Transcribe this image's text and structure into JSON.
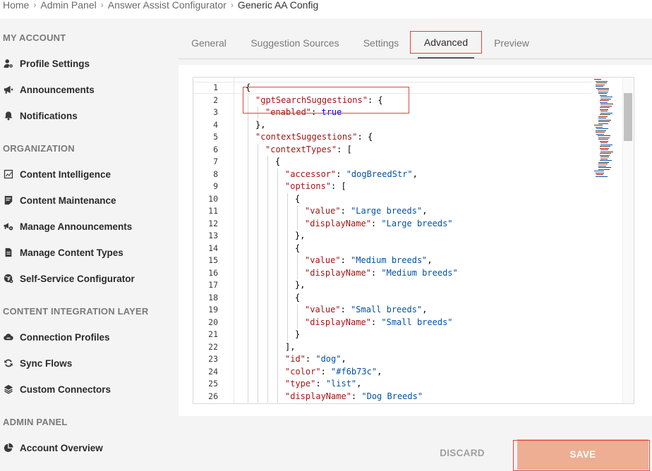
{
  "breadcrumb": {
    "items": [
      "Home",
      "Admin Panel",
      "Answer Assist Configurator"
    ],
    "current": "Generic AA Config",
    "separator": "›"
  },
  "sidebar": {
    "sections": [
      {
        "title": "MY ACCOUNT",
        "items": [
          {
            "label": "Profile Settings",
            "icon": "user-gear-icon"
          },
          {
            "label": "Announcements",
            "icon": "megaphone-icon"
          },
          {
            "label": "Notifications",
            "icon": "bell-icon"
          }
        ]
      },
      {
        "title": "ORGANIZATION",
        "items": [
          {
            "label": "Content Intelligence",
            "icon": "chart-icon"
          },
          {
            "label": "Content Maintenance",
            "icon": "list-check-icon"
          },
          {
            "label": "Manage Announcements",
            "icon": "megaphone-gear-icon"
          },
          {
            "label": "Manage Content Types",
            "icon": "document-icon"
          },
          {
            "label": "Self-Service Configurator",
            "icon": "globe-gear-icon"
          }
        ]
      },
      {
        "title": "CONTENT INTEGRATION LAYER",
        "items": [
          {
            "label": "Connection Profiles",
            "icon": "cloud-icon"
          },
          {
            "label": "Sync Flows",
            "icon": "sync-icon"
          },
          {
            "label": "Custom Connectors",
            "icon": "layers-icon"
          }
        ]
      },
      {
        "title": "ADMIN PANEL",
        "items": [
          {
            "label": "Account Overview",
            "icon": "pie-chart-icon"
          }
        ]
      }
    ]
  },
  "tabs": [
    {
      "label": "General",
      "active": false
    },
    {
      "label": "Suggestion Sources",
      "active": false
    },
    {
      "label": "Settings",
      "active": false
    },
    {
      "label": "Advanced",
      "active": true
    },
    {
      "label": "Preview",
      "active": false
    }
  ],
  "editor": {
    "lines": [
      {
        "n": "1",
        "indent": 0,
        "tokens": [
          [
            "p",
            "{"
          ]
        ]
      },
      {
        "n": "2",
        "indent": 1,
        "tokens": [
          [
            "k",
            "\"gptSearchSuggestions\""
          ],
          [
            "p",
            ": {"
          ]
        ]
      },
      {
        "n": "3",
        "indent": 2,
        "tokens": [
          [
            "k",
            "\"enabled\""
          ],
          [
            "p",
            ": "
          ],
          [
            "b",
            "true"
          ]
        ]
      },
      {
        "n": "4",
        "indent": 1,
        "tokens": [
          [
            "p",
            "},"
          ]
        ]
      },
      {
        "n": "5",
        "indent": 1,
        "tokens": [
          [
            "k",
            "\"contextSuggestions\""
          ],
          [
            "p",
            ": {"
          ]
        ]
      },
      {
        "n": "6",
        "indent": 2,
        "tokens": [
          [
            "k",
            "\"contextTypes\""
          ],
          [
            "p",
            ": ["
          ]
        ]
      },
      {
        "n": "7",
        "indent": 3,
        "tokens": [
          [
            "p",
            "{"
          ]
        ]
      },
      {
        "n": "8",
        "indent": 4,
        "tokens": [
          [
            "k",
            "\"accessor\""
          ],
          [
            "p",
            ": "
          ],
          [
            "s",
            "\"dogBreedStr\""
          ],
          [
            "p",
            ","
          ]
        ]
      },
      {
        "n": "9",
        "indent": 4,
        "tokens": [
          [
            "k",
            "\"options\""
          ],
          [
            "p",
            ": ["
          ]
        ]
      },
      {
        "n": "10",
        "indent": 5,
        "tokens": [
          [
            "p",
            "{"
          ]
        ]
      },
      {
        "n": "11",
        "indent": 6,
        "tokens": [
          [
            "k",
            "\"value\""
          ],
          [
            "p",
            ": "
          ],
          [
            "s",
            "\"Large breeds\""
          ],
          [
            "p",
            ","
          ]
        ]
      },
      {
        "n": "12",
        "indent": 6,
        "tokens": [
          [
            "k",
            "\"displayName\""
          ],
          [
            "p",
            ": "
          ],
          [
            "s",
            "\"Large breeds\""
          ]
        ]
      },
      {
        "n": "13",
        "indent": 5,
        "tokens": [
          [
            "p",
            "},"
          ]
        ]
      },
      {
        "n": "14",
        "indent": 5,
        "tokens": [
          [
            "p",
            "{"
          ]
        ]
      },
      {
        "n": "15",
        "indent": 6,
        "tokens": [
          [
            "k",
            "\"value\""
          ],
          [
            "p",
            ": "
          ],
          [
            "s",
            "\"Medium breeds\""
          ],
          [
            "p",
            ","
          ]
        ]
      },
      {
        "n": "16",
        "indent": 6,
        "tokens": [
          [
            "k",
            "\"displayName\""
          ],
          [
            "p",
            ": "
          ],
          [
            "s",
            "\"Medium breeds\""
          ]
        ]
      },
      {
        "n": "17",
        "indent": 5,
        "tokens": [
          [
            "p",
            "},"
          ]
        ]
      },
      {
        "n": "18",
        "indent": 5,
        "tokens": [
          [
            "p",
            "{"
          ]
        ]
      },
      {
        "n": "19",
        "indent": 6,
        "tokens": [
          [
            "k",
            "\"value\""
          ],
          [
            "p",
            ": "
          ],
          [
            "s",
            "\"Small breeds\""
          ],
          [
            "p",
            ","
          ]
        ]
      },
      {
        "n": "20",
        "indent": 6,
        "tokens": [
          [
            "k",
            "\"displayName\""
          ],
          [
            "p",
            ": "
          ],
          [
            "s",
            "\"Small breeds\""
          ]
        ]
      },
      {
        "n": "21",
        "indent": 5,
        "tokens": [
          [
            "p",
            "}"
          ]
        ]
      },
      {
        "n": "22",
        "indent": 4,
        "tokens": [
          [
            "p",
            "],"
          ]
        ]
      },
      {
        "n": "23",
        "indent": 4,
        "tokens": [
          [
            "k",
            "\"id\""
          ],
          [
            "p",
            ": "
          ],
          [
            "s",
            "\"dog\""
          ],
          [
            "p",
            ","
          ]
        ]
      },
      {
        "n": "24",
        "indent": 4,
        "tokens": [
          [
            "k",
            "\"color\""
          ],
          [
            "p",
            ": "
          ],
          [
            "s",
            "\"#f6b73c\""
          ],
          [
            "p",
            ","
          ]
        ]
      },
      {
        "n": "25",
        "indent": 4,
        "tokens": [
          [
            "k",
            "\"type\""
          ],
          [
            "p",
            ": "
          ],
          [
            "s",
            "\"list\""
          ],
          [
            "p",
            ","
          ]
        ]
      },
      {
        "n": "26",
        "indent": 4,
        "tokens": [
          [
            "k",
            "\"displayName\""
          ],
          [
            "p",
            ": "
          ],
          [
            "s",
            "\"Dog Breeds\""
          ]
        ]
      }
    ]
  },
  "actions": {
    "discard_label": "DISCARD",
    "save_label": "SAVE"
  },
  "colors": {
    "save_button": "#eeae93",
    "highlight_box": "#e0443c",
    "json_key": "#a31515",
    "json_string": "#0451a5",
    "json_boolean": "#0000ff"
  }
}
